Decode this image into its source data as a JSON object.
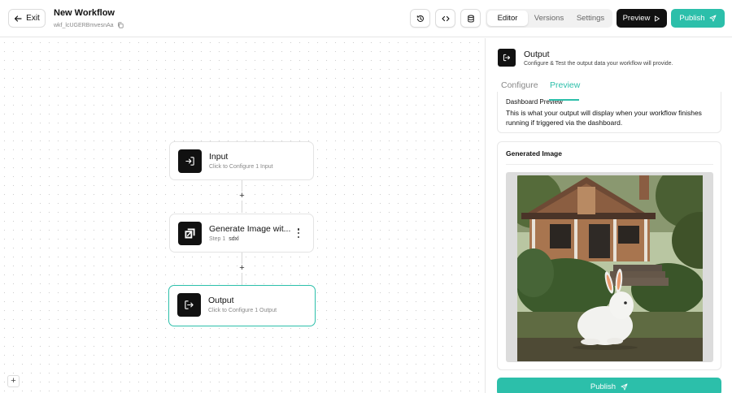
{
  "header": {
    "exit_label": "Exit",
    "workflow_title": "New Workflow",
    "workflow_id": "wkf_lcUGERBmvesnAa",
    "tabs": [
      {
        "label": "Editor",
        "active": true
      },
      {
        "label": "Versions",
        "active": false
      },
      {
        "label": "Settings",
        "active": false
      }
    ],
    "preview_label": "Preview",
    "publish_label": "Publish",
    "icons": [
      "history-icon",
      "code-icon",
      "database-icon"
    ]
  },
  "canvas": {
    "nodes": [
      {
        "title": "Input",
        "subtitle": "Click to Configure 1 Input",
        "icon": "input-icon"
      },
      {
        "title": "Generate Image wit...",
        "subtitle": "Step 1",
        "tag": "sdxl",
        "icon": "model-logo-icon"
      },
      {
        "title": "Output",
        "subtitle": "Click to Configure 1 Output",
        "icon": "output-icon",
        "selected": true
      }
    ],
    "add_symbol": "+",
    "zoom_symbol": "+"
  },
  "panel": {
    "title": "Output",
    "subtitle": "Configure & Test the output data your workflow will provide.",
    "tabs": [
      {
        "label": "Configure",
        "active": false
      },
      {
        "label": "Preview",
        "active": true
      }
    ],
    "dashboard_title": "Dashboard Preview",
    "dashboard_text": "This is what your output will display when your workflow finishes running if triggered via the dashboard.",
    "generated_title": "Generated Image",
    "publish_label": "Publish"
  },
  "colors": {
    "accent": "#2cbfaa",
    "dark": "#111111"
  }
}
